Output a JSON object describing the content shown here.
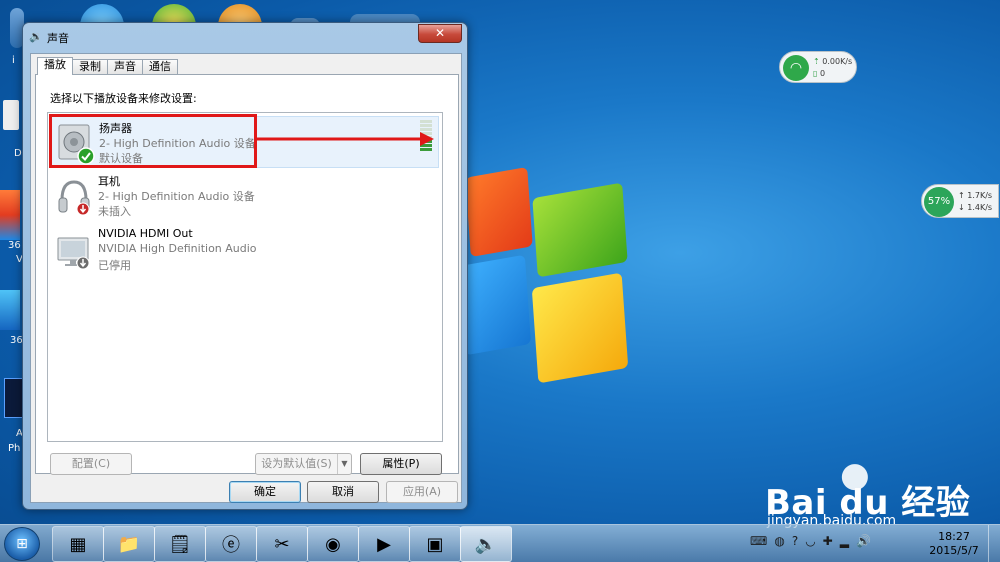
{
  "desktop": {
    "left_labels": [
      "i",
      "D",
      "36",
      "V",
      "36",
      "A",
      "Ph"
    ],
    "network_widget": {
      "upload": "0.00K/s",
      "download": "0"
    },
    "cpu_widget": {
      "percent": "57%",
      "upload": "1.7K/s",
      "download": "1.4K/s"
    },
    "watermark": {
      "brand": "Bai du 经验",
      "site": "jingyan.baidu.com"
    }
  },
  "dialog": {
    "title": "声音",
    "close_label": "✕",
    "tabs": [
      {
        "label": "播放",
        "active": true
      },
      {
        "label": "录制",
        "active": false
      },
      {
        "label": "声音",
        "active": false
      },
      {
        "label": "通信",
        "active": false
      }
    ],
    "instruction": "选择以下播放设备来修改设置:",
    "devices": [
      {
        "name": "扬声器",
        "description": "2- High Definition Audio 设备",
        "status": "默认设备",
        "selected": true,
        "icon": "speaker-icon",
        "badge": "check-badge-icon",
        "level_bars_on": 3,
        "level_bars_total": 8
      },
      {
        "name": "耳机",
        "description": "2- High Definition Audio 设备",
        "status": "未插入",
        "selected": false,
        "icon": "headphones-icon",
        "badge": "unplugged-badge-icon"
      },
      {
        "name": "NVIDIA HDMI Out",
        "description": "NVIDIA High Definition Audio",
        "status": "已停用",
        "selected": false,
        "icon": "monitor-icon",
        "badge": "disabled-badge-icon"
      }
    ],
    "buttons": {
      "configure": "配置(C)",
      "set_default": "设为默认值(S)",
      "properties": "属性(P)",
      "ok": "确定",
      "cancel": "取消",
      "apply": "应用(A)"
    }
  },
  "taskbar": {
    "start_label": "⊞",
    "items": [
      {
        "icon": "windows-explorer-tiles-icon",
        "glyph": "▦"
      },
      {
        "icon": "folder-icon",
        "glyph": "📁"
      },
      {
        "icon": "sticky-notes-icon",
        "glyph": "🗒"
      },
      {
        "icon": "ie-browser-icon",
        "glyph": "ⓔ"
      },
      {
        "icon": "snipping-tool-icon",
        "glyph": "✂"
      },
      {
        "icon": "chrome-icon",
        "glyph": "◉"
      },
      {
        "icon": "media-player-icon",
        "glyph": "▶"
      },
      {
        "icon": "screen-recorder-icon",
        "glyph": "▣"
      },
      {
        "icon": "sound-speaker-icon",
        "glyph": "🔈"
      }
    ],
    "clock": {
      "time": "18:27",
      "date": "2015/5/7"
    }
  },
  "colors": {
    "highlight": "#e01818",
    "titlebar": "#a9c9e6",
    "close": "#c74a3b"
  }
}
